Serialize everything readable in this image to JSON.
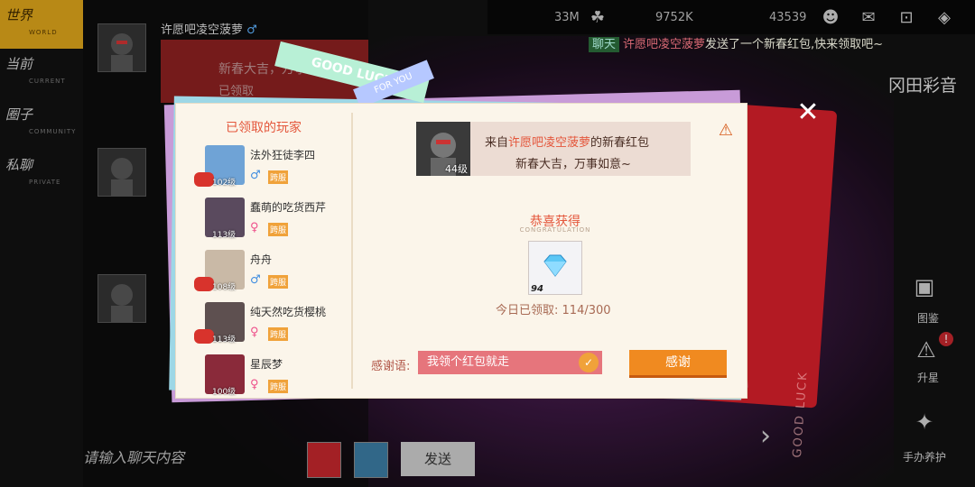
{
  "left_tabs": [
    {
      "label": "世界",
      "sub": "WORLD",
      "active": true
    },
    {
      "label": "当前",
      "sub": "CURRENT",
      "active": false
    },
    {
      "label": "圈子",
      "sub": "COMMUNITY",
      "active": false
    },
    {
      "label": "私聊",
      "sub": "PRIVATE",
      "active": false
    }
  ],
  "chat": {
    "sender_name": "许愿吧凌空菠萝",
    "gender_symbol": "♂",
    "bubble_line1": "新春大吉，万事如意~",
    "bubble_line2": "已领取",
    "input_placeholder": "请输入聊天内容",
    "send_label": "发送"
  },
  "topbar": {
    "stat1": "33M",
    "stat2": "9752K",
    "stat3": "43539"
  },
  "system_message": {
    "tag": "聊天",
    "who": "许愿吧凌空菠萝",
    "text": "发送了一个新春红包,快来领取吧~"
  },
  "right_panel": {
    "name": "冈田彩音",
    "label1": "图鉴",
    "label2": "升星",
    "label3": "手办养护",
    "badge": "!"
  },
  "envelope": {
    "deco_text": "GOOD LUCK"
  },
  "ribbon_text": "GOOD LUCK",
  "ribbon2_text": "FOR YOU",
  "modal": {
    "players_title": "已领取的玩家",
    "players": [
      {
        "name": "法外狂徒李四",
        "level": "102级",
        "gender": "♂",
        "tag": "跨服"
      },
      {
        "name": "蠢萌的吃货西芹",
        "level": "113级",
        "gender": "♀",
        "tag": "跨服"
      },
      {
        "name": "舟舟",
        "level": "108级",
        "gender": "♂",
        "tag": "跨服"
      },
      {
        "name": "纯天然吃货樱桃",
        "level": "113级",
        "gender": "♀",
        "tag": "跨服"
      },
      {
        "name": "星辰梦",
        "level": "100级",
        "gender": "♀",
        "tag": "跨服"
      }
    ],
    "sender_prefix": "来自",
    "sender_name": "许愿吧凌空菠萝",
    "sender_suffix": "的新春红包",
    "sender_level": "44级",
    "blessing": "新春大吉，万事如意~",
    "congrats": "恭喜获得",
    "congrats_sub": "CONGRATULATION",
    "reward_count": "94",
    "daily_label": "今日已领取:",
    "daily_value": "114/300",
    "thanks_label": "感谢语:",
    "thanks_value": "我领个红包就走",
    "thank_button": "感谢",
    "close_symbol": "✕"
  },
  "colors": {
    "accent": "#e4573c",
    "button": "#f08a20",
    "tab_active": "#d9a21a"
  }
}
